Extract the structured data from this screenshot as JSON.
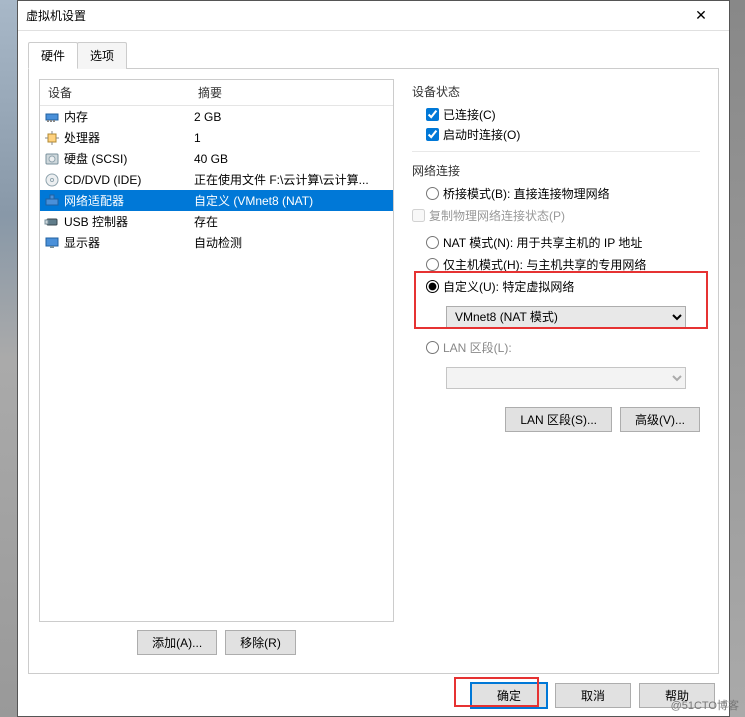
{
  "title": "虚拟机设置",
  "tabs": {
    "hardware": "硬件",
    "options": "选项"
  },
  "headers": {
    "device": "设备",
    "summary": "摘要"
  },
  "devices": [
    {
      "icon": "memory-icon",
      "name": "内存",
      "summary": "2 GB"
    },
    {
      "icon": "cpu-icon",
      "name": "处理器",
      "summary": "1"
    },
    {
      "icon": "disk-icon",
      "name": "硬盘 (SCSI)",
      "summary": "40 GB"
    },
    {
      "icon": "cd-icon",
      "name": "CD/DVD (IDE)",
      "summary": "正在使用文件 F:\\云计算\\云计算..."
    },
    {
      "icon": "network-icon",
      "name": "网络适配器",
      "summary": "自定义 (VMnet8 (NAT)"
    },
    {
      "icon": "usb-icon",
      "name": "USB 控制器",
      "summary": "存在"
    },
    {
      "icon": "display-icon",
      "name": "显示器",
      "summary": "自动检测"
    }
  ],
  "selected_index": 4,
  "buttons": {
    "add": "添加(A)...",
    "remove": "移除(R)",
    "ok": "确定",
    "cancel": "取消",
    "help": "帮助"
  },
  "right": {
    "status_label": "设备状态",
    "connected": "已连接(C)",
    "connect_on": "启动时连接(O)",
    "net_label": "网络连接",
    "bridged": "桥接模式(B): 直接连接物理网络",
    "replicate": "复制物理网络连接状态(P)",
    "nat": "NAT 模式(N): 用于共享主机的 IP 地址",
    "hostonly": "仅主机模式(H): 与主机共享的专用网络",
    "custom": "自定义(U): 特定虚拟网络",
    "custom_value": "VMnet8 (NAT 模式)",
    "lan": "LAN 区段(L):",
    "lan_value": "",
    "lan_segments": "LAN 区段(S)...",
    "advanced": "高级(V)..."
  },
  "watermark": "@51CTO博客"
}
